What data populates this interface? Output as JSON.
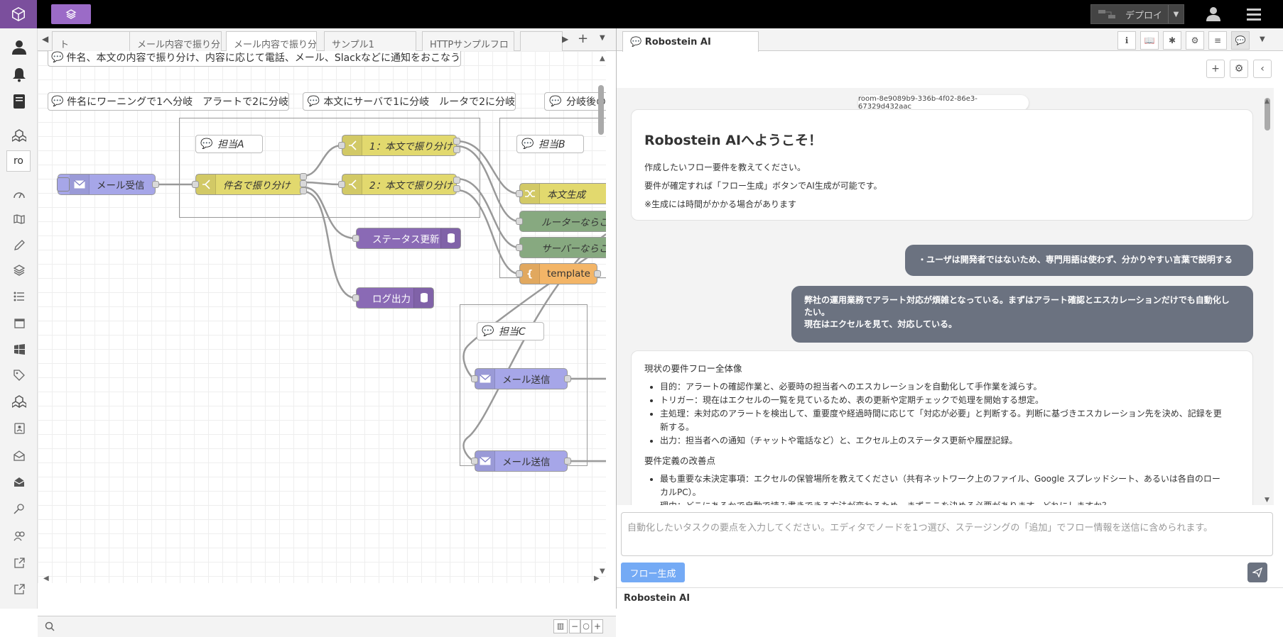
{
  "header": {
    "deploy_label": "デプロイ"
  },
  "sidebar": {
    "ro_label": "ro"
  },
  "workspace": {
    "tabs": [
      {
        "label": "ト"
      },
      {
        "label": "メール内容で振り分"
      },
      {
        "label": "メール内容で振り分"
      },
      {
        "label": "サンプル1"
      },
      {
        "label": "HTTPサンプルフロ"
      },
      {
        "label": ""
      }
    ],
    "comments": [
      {
        "text": "件名、本文の内容で振り分け、内容に応じて電話、メール、Slackなどに通知をおこなう"
      },
      {
        "text": "件名にワーニングで1へ分岐　アラートで2に分岐"
      },
      {
        "text": "本文にサーバで1に分岐　ルータで2に分岐"
      },
      {
        "text": "分岐後の"
      }
    ],
    "nodes": {
      "mail_receive": "メール受信",
      "tantou_a": "担当A",
      "tantou_b": "担当B",
      "tantou_c": "担当C",
      "subject_switch": "件名で振り分け",
      "body_switch_1": "1：本文で振り分け",
      "body_switch_2": "2：本文で振り分け",
      "status_update": "ステータス更新",
      "log_output": "ログ出力",
      "body_gen": "本文生成",
      "router": "ルーターならこ",
      "server": "サーバーならこ",
      "template": "template",
      "mail_send_1": "メール送信",
      "mail_send_2": "メール送信"
    }
  },
  "rpanel": {
    "tab_label": "Robostein AI",
    "room_id": "room-8e9089b9-336b-4f02-86e3-67329d432aac",
    "welcome": {
      "title": "Robostein AIへようこそ！",
      "lines": [
        "作成したいフロー要件を教えてください。",
        "要件が確定すれば「フロー生成」ボタンでAI生成が可能です。",
        "※生成には時間がかかる場合があります"
      ]
    },
    "user_msg_1": "・ユーザは開発者ではないため、専門用語は使わず、分かりやすい言葉で説明する",
    "user_msg_2": {
      "line1": "弊社の運用業務でアラート対応が煩雑となっている。まずはアラート確認とエスカレーションだけでも自動化し",
      "line2": "たい。",
      "line3": "現在はエクセルを見て、対応している。"
    },
    "reply": {
      "heading1": "現状の要件フロー全体像",
      "items1": [
        "目的：アラートの確認作業と、必要時の担当者へのエスカレーションを自動化して手作業を減らす。",
        "トリガー：現在はエクセルの一覧を見ているため、表の更新や定期チェックで処理を開始する想定。",
        "主処理：未対応のアラートを検出して、重要度や経過時間に応じて「対応が必要」と判断する。判断に基づきエスカレーション先を決め、記録を更",
        "新する。",
        "出力：担当者への通知（チャットや電話など）と、エクセル上のステータス更新や履歴記録。"
      ],
      "heading2": "要件定義の改善点",
      "items2": [
        "最も重要な未決定事項：エクセルの保管場所を教えてください（共有ネットワーク上のファイル、Google スプレッドシート、あるいは各自のロー",
        "カルPC）。",
        "理由：どこにあるかで自動で読み書きできる方法が変わるため、まずここを決める必要があります。どれにしますか？"
      ]
    },
    "input_placeholder": "自動化したいタスクの要点を入力してください。エディタでノードを1つ選び、ステージングの「追加」でフロー情報を送信に含められます。",
    "generate_label": "フロー生成",
    "footer_label": "Robostein AI"
  },
  "colors": {
    "header_bg": "#000000",
    "logo_bg": "#7b4f9d",
    "switch_node": "#e2d96e",
    "email_node": "#a6a6e8",
    "db_node": "#8a6ab5",
    "change_node": "#87a980",
    "template_node": "#f3b567",
    "bubble": "#6b7280",
    "generate_btn": "#74aaf5"
  }
}
